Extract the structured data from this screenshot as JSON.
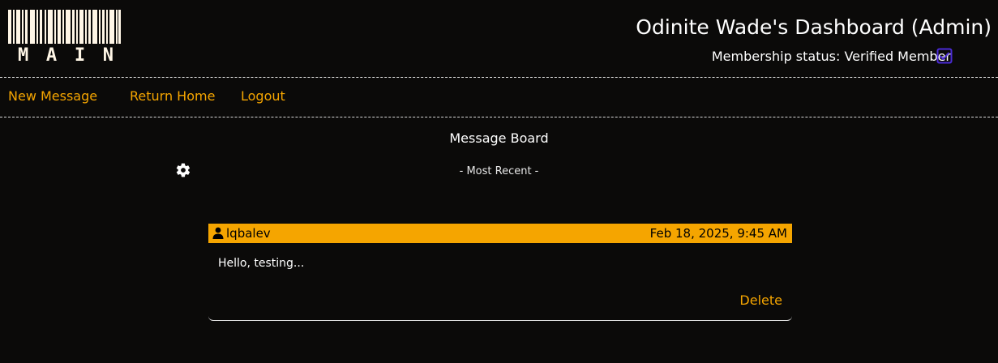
{
  "brand": {
    "logo_text": [
      "M",
      "A",
      "I",
      "N"
    ],
    "logo_color": "#fff6e6"
  },
  "header": {
    "title": "Odinite Wade's Dashboard (Admin)",
    "membership_label": "Membership status: Verified Member",
    "verified_icon": "checkbox-checked-icon",
    "verified_color": "#4b2bd6"
  },
  "nav": {
    "items": [
      {
        "label": "New Message"
      },
      {
        "label": "Return Home"
      },
      {
        "label": "Logout"
      }
    ],
    "link_color": "#f5a500"
  },
  "board": {
    "title": "Message Board",
    "sort_label": "- Most Recent -",
    "settings_icon": "gear-icon",
    "messages": [
      {
        "user": "lqbalev",
        "user_icon": "user-icon",
        "timestamp": "Feb 18, 2025, 9:45 AM",
        "body": "Hello, testing...",
        "delete_label": "Delete"
      }
    ]
  },
  "colors": {
    "accent": "#f5a500",
    "background": "#0b0a09",
    "text": "#ffffff"
  }
}
